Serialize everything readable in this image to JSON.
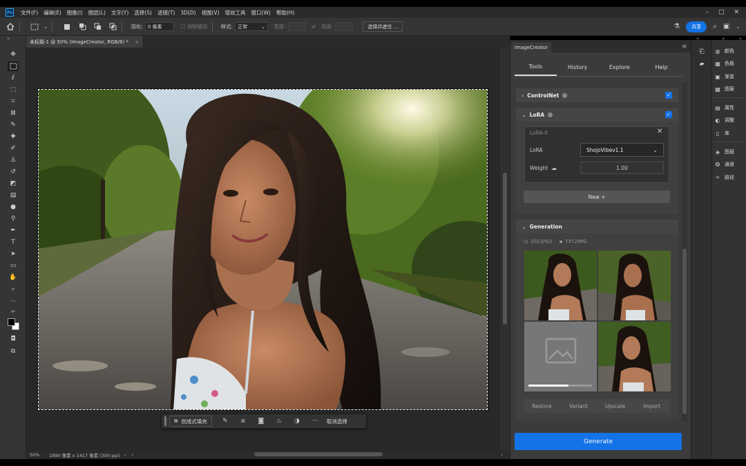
{
  "app": {
    "logo_text": "Ps"
  },
  "menubar": {
    "items": [
      "文件(F)",
      "编辑(E)",
      "图像(I)",
      "图层(L)",
      "文字(Y)",
      "选择(S)",
      "滤镜(T)",
      "3D(D)",
      "视图(V)",
      "增效工具",
      "窗口(W)",
      "帮助(H)"
    ],
    "window_controls": [
      "–",
      "□",
      "✕"
    ]
  },
  "options_bar": {
    "feather_label": "羽化:",
    "feather_value": "0 像素",
    "antialias_label": "消除锯齿",
    "style_label": "样式:",
    "style_value": "正常",
    "width_label": "宽度:",
    "height_label": "高度:",
    "select_mask_button": "选择并遮住 ...",
    "share_button": "共享"
  },
  "document": {
    "tab_title": "未标题-1 @ 50% (ImageCreator, RGB/8) *",
    "tab_close": "×"
  },
  "context_bar": {
    "generative_fill": "创成式填充",
    "deselect": "取消选择",
    "more": "···"
  },
  "status_bar": {
    "zoom": "50%",
    "doc_info": "1890 像素 x 1417 像素 (300 ppi)"
  },
  "plugin": {
    "panel_tab": "ImageCreator",
    "tabs": [
      "Tools",
      "History",
      "Explore",
      "Help"
    ],
    "active_tab": "Tools",
    "controlnet": {
      "label": "ControlNet",
      "enabled": true
    },
    "lora": {
      "label": "LoRA",
      "enabled": true,
      "card_title": "LoRA-0",
      "lora_label": "LoRA",
      "lora_value": "ShojoVibev1.1",
      "weight_label": "Weight",
      "weight_value": "1.00",
      "new_button": "New +"
    },
    "generation": {
      "label": "Generation",
      "date": "2023/9/2",
      "mode": "TXT2IMG",
      "progress": 0.63,
      "actions": [
        "Restore",
        "Variant",
        "Upscale",
        "Import"
      ]
    },
    "generate_button": "Generate"
  },
  "right_dock": {
    "panels": [
      "颜色",
      "色板",
      "渐变",
      "图案",
      "属性",
      "调整",
      "库",
      "图层",
      "通道",
      "路径"
    ]
  },
  "colors": {
    "accent": "#1473e6",
    "panel_bg": "#3b3b3b",
    "app_bg": "#282828"
  }
}
